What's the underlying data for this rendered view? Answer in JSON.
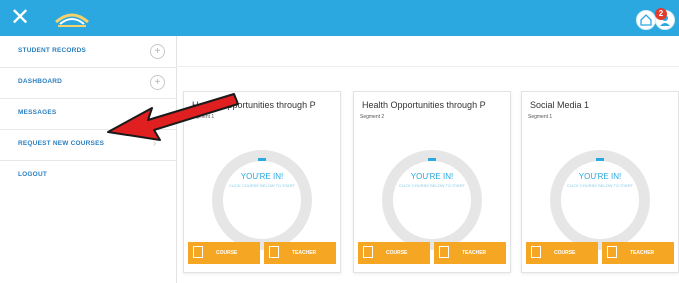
{
  "header": {
    "close_glyph": "✕",
    "notification_count": "2"
  },
  "sidebar": {
    "items": [
      {
        "label": "STUDENT RECORDS",
        "icon": "plus-circle-icon",
        "glyph": "+"
      },
      {
        "label": "DASHBOARD",
        "icon": "plus-circle-icon",
        "glyph": "+"
      },
      {
        "label": "MESSAGES",
        "icon": "",
        "glyph": ""
      },
      {
        "label": "REQUEST NEW COURSES",
        "icon": "chevron-right-icon",
        "glyph": "›"
      },
      {
        "label": "LOGOUT",
        "icon": "",
        "glyph": ""
      }
    ]
  },
  "cards": [
    {
      "title": "Health Opportunities through P",
      "segment": "Segment 1",
      "dash": "–",
      "status": "YOU'RE IN!",
      "hint": "CLICK COURSE BELOW TO START",
      "course_label": "COURSE",
      "teacher_label": "TEACHER"
    },
    {
      "title": "Health Opportunities through P",
      "segment": "Segment 2",
      "dash": "–",
      "status": "YOU'RE IN!",
      "hint": "CLICK COURSE BELOW TO START",
      "course_label": "COURSE",
      "teacher_label": "TEACHER"
    },
    {
      "title": "Social Media 1",
      "segment": "Segment 1",
      "dash": "–",
      "status": "YOU'RE IN!",
      "hint": "CLICK COURSE BELOW TO START",
      "course_label": "COURSE",
      "teacher_label": "TEACHER"
    }
  ],
  "colors": {
    "header": "#2ba8e0",
    "accent_orange": "#f5a623",
    "arrow_red": "#e02020",
    "sidebar_text": "#2b7fc0"
  }
}
